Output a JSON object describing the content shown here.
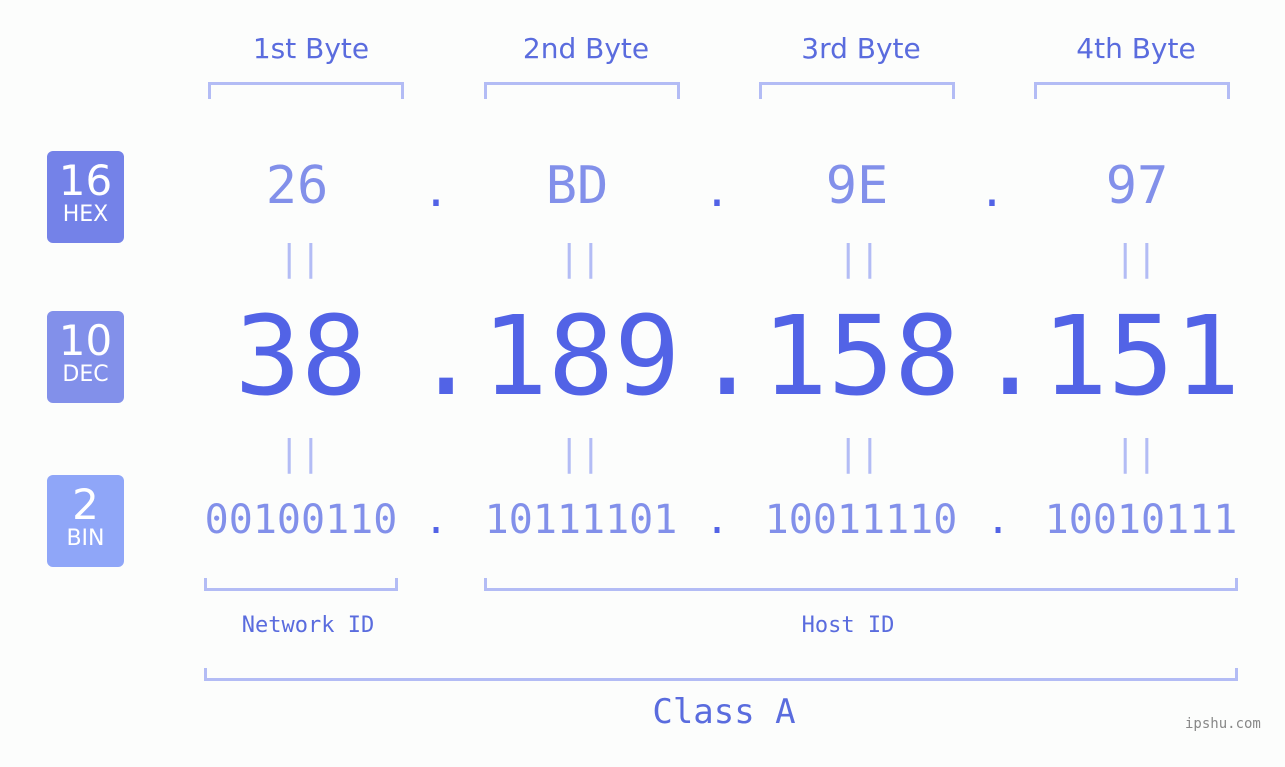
{
  "headers": [
    "1st Byte",
    "2nd Byte",
    "3rd Byte",
    "4th Byte"
  ],
  "badges": [
    {
      "number": "16",
      "label": "HEX",
      "color": "#7482e8"
    },
    {
      "number": "10",
      "label": "DEC",
      "color": "#8290ea"
    },
    {
      "number": "2",
      "label": "BIN",
      "color": "#8fa6f8"
    }
  ],
  "hex": [
    "26",
    "BD",
    "9E",
    "97"
  ],
  "dec": [
    "38",
    "189",
    "158",
    "151"
  ],
  "bin": [
    "00100110",
    "10111101",
    "10011110",
    "10010111"
  ],
  "separator": ".",
  "equals": "=",
  "network_label": "Network ID",
  "host_label": "Host ID",
  "class_label": "Class A",
  "watermark": "ipshu.com"
}
